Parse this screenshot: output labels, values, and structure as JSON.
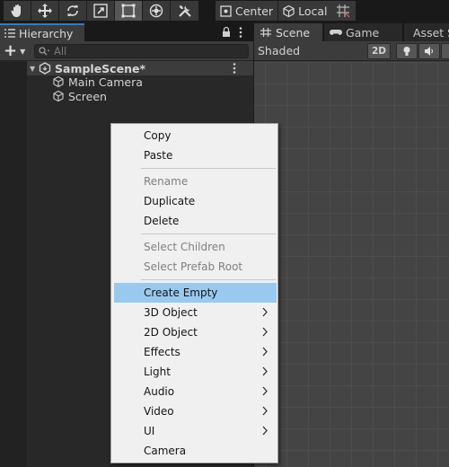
{
  "toolbar": {
    "tools": [
      {
        "name": "hand-tool",
        "icon": "hand-icon",
        "active": false
      },
      {
        "name": "move-tool",
        "icon": "move-arrows-icon",
        "active": false
      },
      {
        "name": "rotate-tool",
        "icon": "rotate-icon",
        "active": false
      },
      {
        "name": "scale-tool",
        "icon": "scale-icon",
        "active": false
      },
      {
        "name": "rect-tool",
        "icon": "rect-transform-icon",
        "active": true
      },
      {
        "name": "transform-tool",
        "icon": "transform-icon",
        "active": false
      },
      {
        "name": "custom-tool",
        "icon": "tools-icon",
        "active": false
      }
    ],
    "pivot_label": "Center",
    "space_label": "Local",
    "snap_icon": "grid-snap-icon"
  },
  "hierarchy": {
    "tab_label": "Hierarchy",
    "search_placeholder": "All",
    "scene_name": "SampleScene*",
    "items": [
      {
        "label": "Main Camera",
        "icon": "gameobject-cube-icon"
      },
      {
        "label": "Screen",
        "icon": "gameobject-cube-icon"
      }
    ]
  },
  "scene_view": {
    "tabs": [
      {
        "label": "Scene",
        "icon": "grid-icon",
        "active": true
      },
      {
        "label": "Game",
        "icon": "gamepad-icon",
        "active": false
      },
      {
        "label": "Asset S",
        "icon": "store-icon",
        "active": false
      }
    ],
    "draw_mode": "Shaded",
    "mode_2d_label": "2D"
  },
  "context_menu": {
    "items": {
      "copy": {
        "label": "Copy",
        "enabled": true
      },
      "paste": {
        "label": "Paste",
        "enabled": true
      },
      "rename": {
        "label": "Rename",
        "enabled": false
      },
      "duplicate": {
        "label": "Duplicate",
        "enabled": true
      },
      "delete": {
        "label": "Delete",
        "enabled": true
      },
      "select_children": {
        "label": "Select Children",
        "enabled": false
      },
      "select_prefab_root": {
        "label": "Select Prefab Root",
        "enabled": false
      },
      "create_empty": {
        "label": "Create Empty",
        "enabled": true,
        "highlighted": true
      },
      "object_3d": {
        "label": "3D Object",
        "enabled": true,
        "submenu": true
      },
      "object_2d": {
        "label": "2D Object",
        "enabled": true,
        "submenu": true
      },
      "effects": {
        "label": "Effects",
        "enabled": true,
        "submenu": true
      },
      "light": {
        "label": "Light",
        "enabled": true,
        "submenu": true
      },
      "audio": {
        "label": "Audio",
        "enabled": true,
        "submenu": true
      },
      "video": {
        "label": "Video",
        "enabled": true,
        "submenu": true
      },
      "ui": {
        "label": "UI",
        "enabled": true,
        "submenu": true
      },
      "camera": {
        "label": "Camera",
        "enabled": true
      }
    }
  },
  "colors": {
    "editor_bg": "#282828",
    "toolbar_bg": "#191919",
    "tab_accent": "#3a79bb",
    "menu_bg": "#f0f0f0",
    "menu_highlight": "#99c9ef",
    "menu_disabled_text": "#808080"
  }
}
